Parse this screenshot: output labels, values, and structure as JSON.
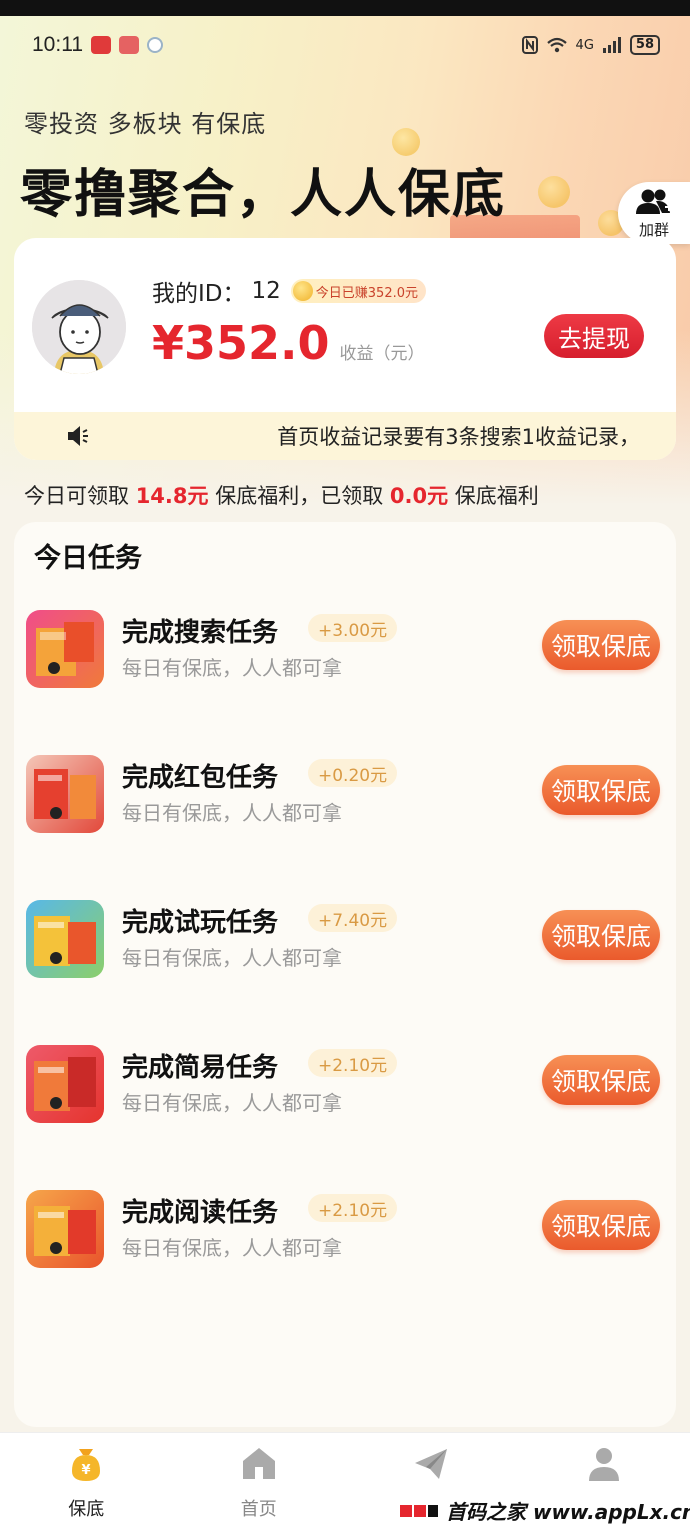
{
  "status_bar": {
    "time": "10:11",
    "battery": "58",
    "network": "4G"
  },
  "hero": {
    "subtitle": "零投资 多板块 有保底",
    "headline": "零撸聚合，人人保底",
    "join_group_label": "加群"
  },
  "profile": {
    "id_label": "我的ID：",
    "id_value": "12",
    "today_badge": "今日已赚352.0元",
    "balance": "¥352.0",
    "balance_unit": "收益（元）",
    "withdraw_label": "去提现"
  },
  "notice": {
    "text": "首页收益记录要有3条搜索1收益记录，"
  },
  "welfare": {
    "prefix": "今日可领取 ",
    "available": "14.8元",
    "middle": " 保底福利，已领取 ",
    "claimed": "0.0元",
    "suffix": " 保底福利"
  },
  "tasks": {
    "title": "今日任务",
    "button_label": "领取保底",
    "desc": "每日有保底，人人都可拿",
    "items": [
      {
        "name": "完成搜索任务",
        "reward": "+3.00元"
      },
      {
        "name": "完成红包任务",
        "reward": "+0.20元"
      },
      {
        "name": "完成试玩任务",
        "reward": "+7.40元"
      },
      {
        "name": "完成简易任务",
        "reward": "+2.10元"
      },
      {
        "name": "完成阅读任务",
        "reward": "+2.10元"
      }
    ]
  },
  "tabbar": {
    "items": [
      {
        "label": "保底",
        "icon": "money-bag-icon",
        "active": true
      },
      {
        "label": "首页",
        "icon": "home-icon",
        "active": false
      },
      {
        "label": "",
        "icon": "paper-plane-icon",
        "active": false
      },
      {
        "label": "",
        "icon": "user-icon",
        "active": false
      }
    ]
  },
  "watermark": {
    "text": "首码之家 www.appLx.cn"
  },
  "colors": {
    "accent_red": "#e5262e",
    "task_button": "#ea5a2c",
    "reward_text": "#d99a44"
  }
}
